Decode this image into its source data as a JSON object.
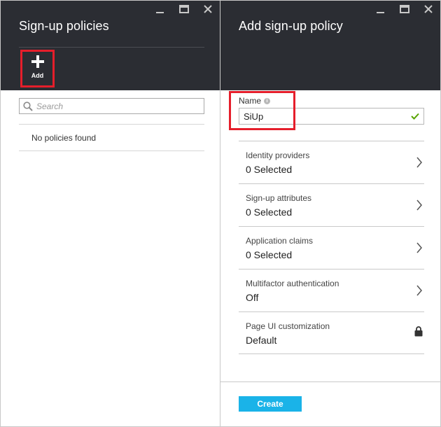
{
  "left_blade": {
    "title": "Sign-up policies",
    "command_add": {
      "label": "Add",
      "icon": "plus-icon"
    },
    "search": {
      "placeholder": "Search",
      "value": ""
    },
    "empty_message": "No policies found"
  },
  "right_blade": {
    "title": "Add sign-up policy",
    "name_field": {
      "label": "Name",
      "value": "SiUp",
      "valid": true
    },
    "settings": [
      {
        "label": "Identity providers",
        "value": "0 Selected",
        "icon": "chevron-right-icon"
      },
      {
        "label": "Sign-up attributes",
        "value": "0 Selected",
        "icon": "chevron-right-icon"
      },
      {
        "label": "Application claims",
        "value": "0 Selected",
        "icon": "chevron-right-icon"
      },
      {
        "label": "Multifactor authentication",
        "value": "Off",
        "icon": "chevron-right-icon"
      },
      {
        "label": "Page UI customization",
        "value": "Default",
        "icon": "lock-icon"
      }
    ],
    "create_label": "Create"
  },
  "colors": {
    "header_bg": "#2b2d33",
    "highlight_red": "#e51e2b",
    "valid_green": "#57a300",
    "create_button": "#1ab3e8"
  }
}
